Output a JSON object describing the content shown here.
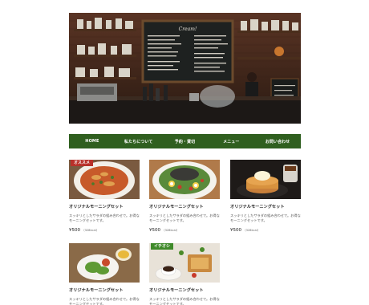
{
  "nav": {
    "items": [
      "HOME",
      "私たちについて",
      "予約・貸切",
      "メニュー",
      "お問い合わせ"
    ]
  },
  "cards": [
    {
      "badge": "オススメ",
      "name": "オリジナルモーニングセット",
      "desc": "スッキリとしたサラダの組み合わせで。お得なモーニングセットです。",
      "price": "¥500",
      "price_note": "（328kcal）"
    },
    {
      "badge": "",
      "name": "オリジナルモーニングセット",
      "desc": "スッキリとしたサラダの組み合わせで。お得なモーニングセットです。",
      "price": "¥500",
      "price_note": "（328kcal）"
    },
    {
      "badge": "",
      "name": "オリジナルモーニングセット",
      "desc": "スッキリとしたサラダの組み合わせで。お得なモーニングセットです。",
      "price": "¥500",
      "price_note": "（328kcal）"
    },
    {
      "badge": "",
      "name": "オリジナルモーニングセット",
      "desc": "スッキリとしたサラダの組み合わせで。お得なモーニングセットです。",
      "price": "",
      "price_note": ""
    },
    {
      "badge": "イチオシ",
      "name": "オリジナルモーニングセット",
      "desc": "スッキリとしたサラダの組み合わせで。お得なモーニングセットです。",
      "price": "",
      "price_note": ""
    }
  ],
  "colors": {
    "nav_bg": "#2f5f1f",
    "badge_red": "#b8312a",
    "badge_green": "#3f8a2a"
  }
}
